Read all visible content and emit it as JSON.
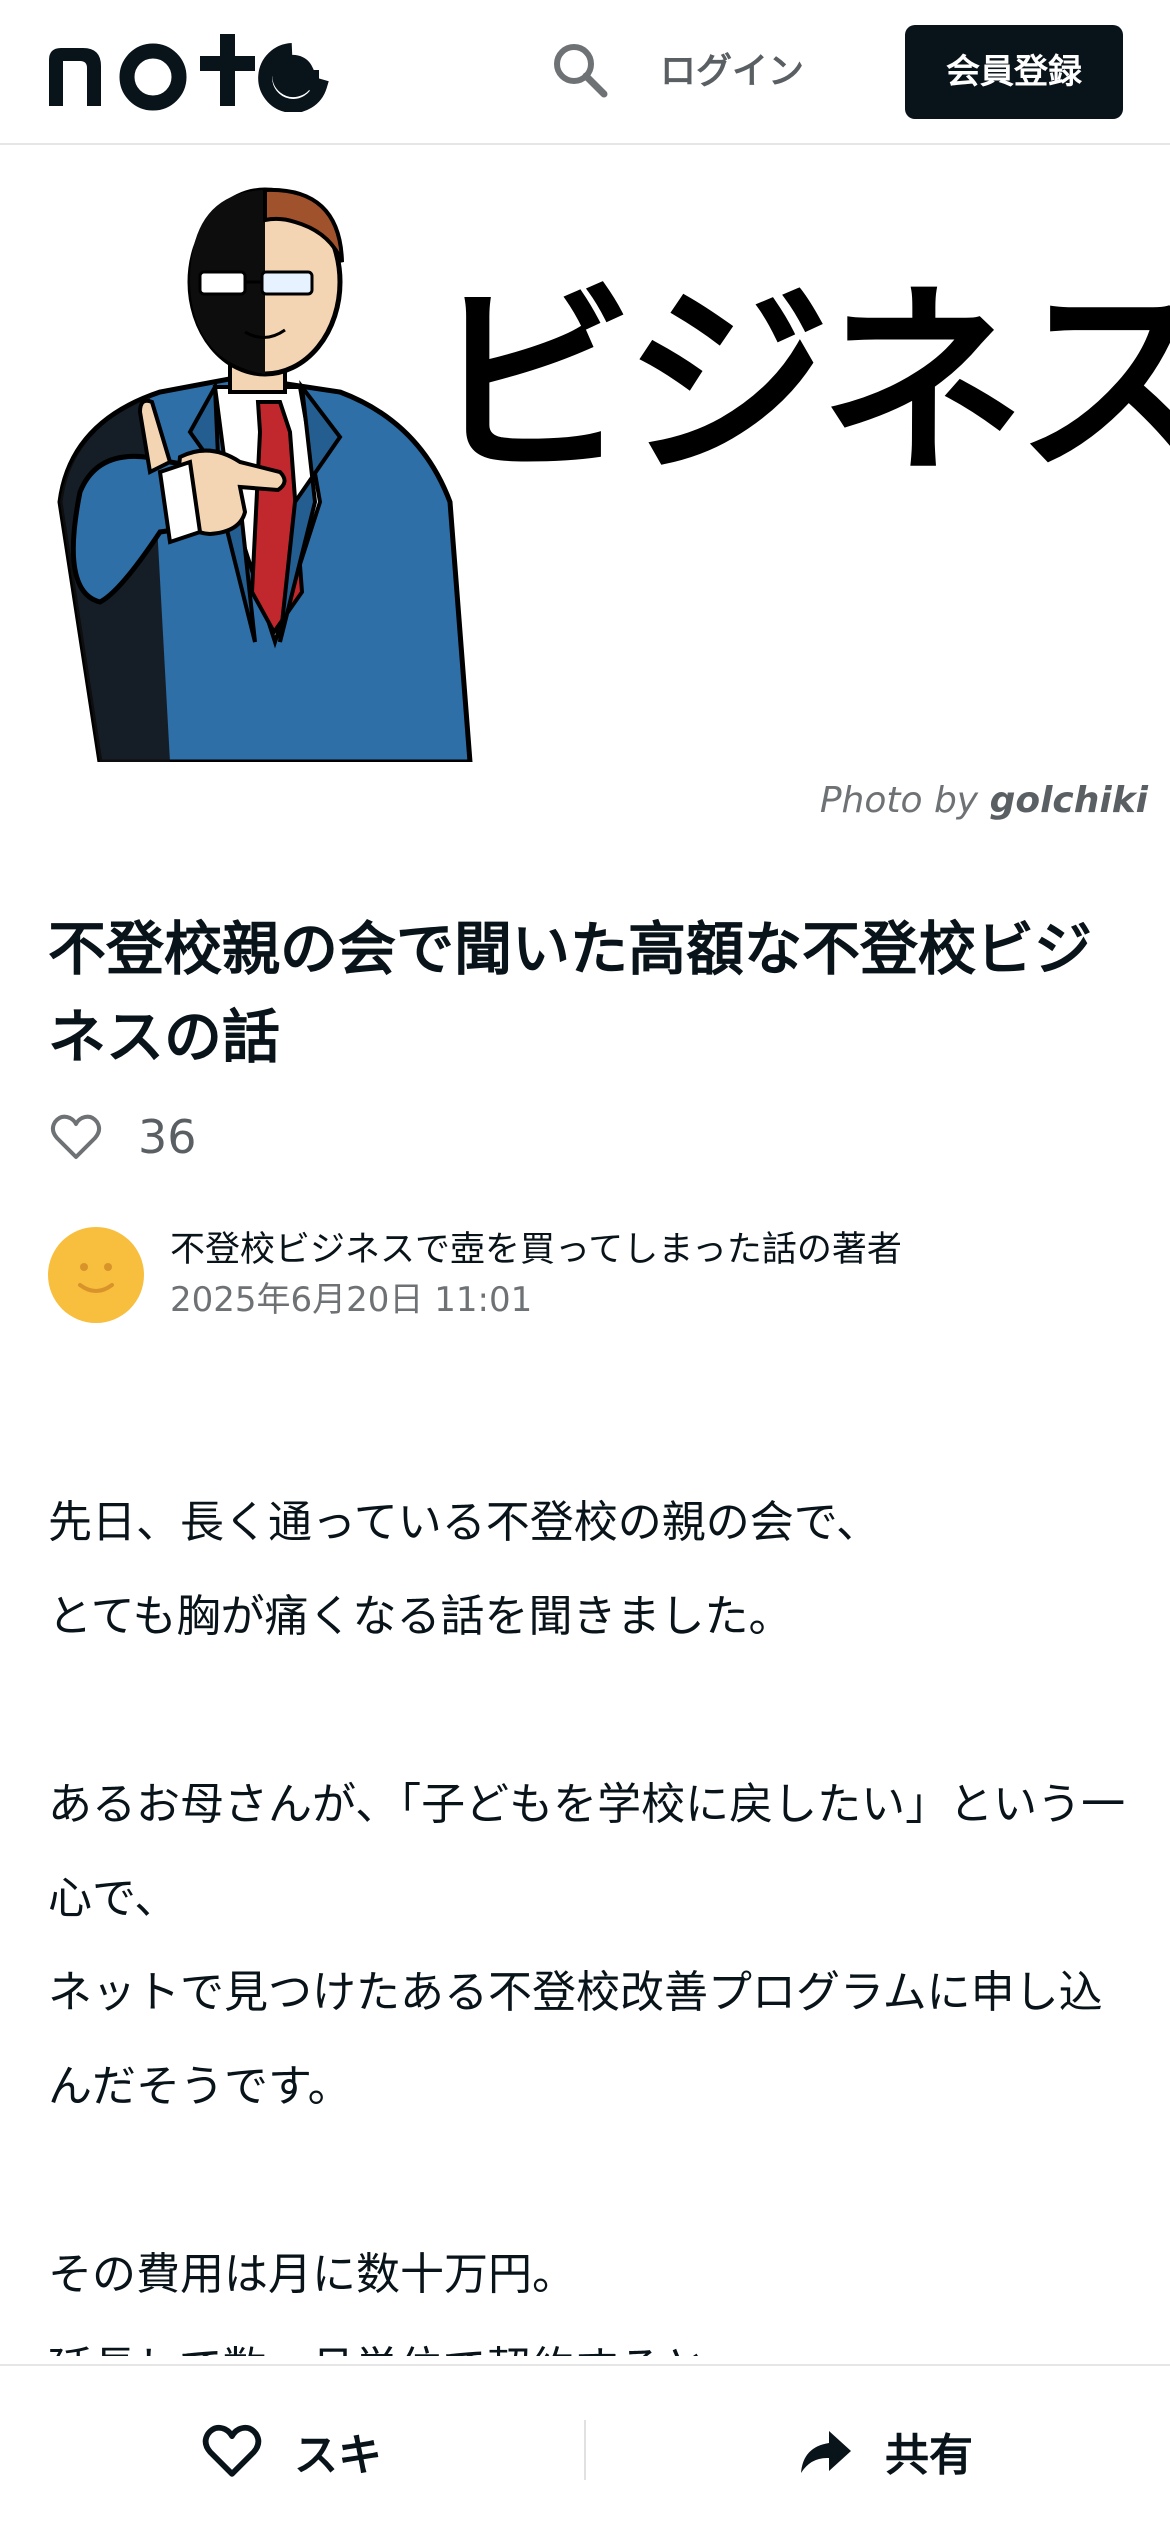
{
  "header": {
    "logo_text": "note",
    "search_icon": "search-icon",
    "login_label": "ログイン",
    "signup_label": "会員登録"
  },
  "hero": {
    "image_text": "ビジネス",
    "credit_prefix": "Photo by",
    "credit_author": "golchiki"
  },
  "article": {
    "title": "不登校親の会で聞いた高額な不登校ビジネスの話",
    "like_count": "36",
    "author_name": "不登校ビジネスで壺を買ってしまった話の著者",
    "date": "2025年6月20日 11:01",
    "paragraphs": [
      "先日、長く通っている不登校の親の会で、\nとても胸が痛くなる話を聞きました。",
      "あるお母さんが、「子どもを学校に戻したい」という一心で、\nネットで見つけたある不登校改善プログラムに申し込んだそうです。",
      "その費用は月に数十万円。\n延長して数ヶ月単位で契約すると"
    ]
  },
  "bottombar": {
    "like_label": "スキ",
    "share_label": "共有"
  },
  "colors": {
    "text": "#08131a",
    "avatar": "#f8be3e",
    "signup_bg": "#08131a",
    "muted": "#6e7275"
  }
}
